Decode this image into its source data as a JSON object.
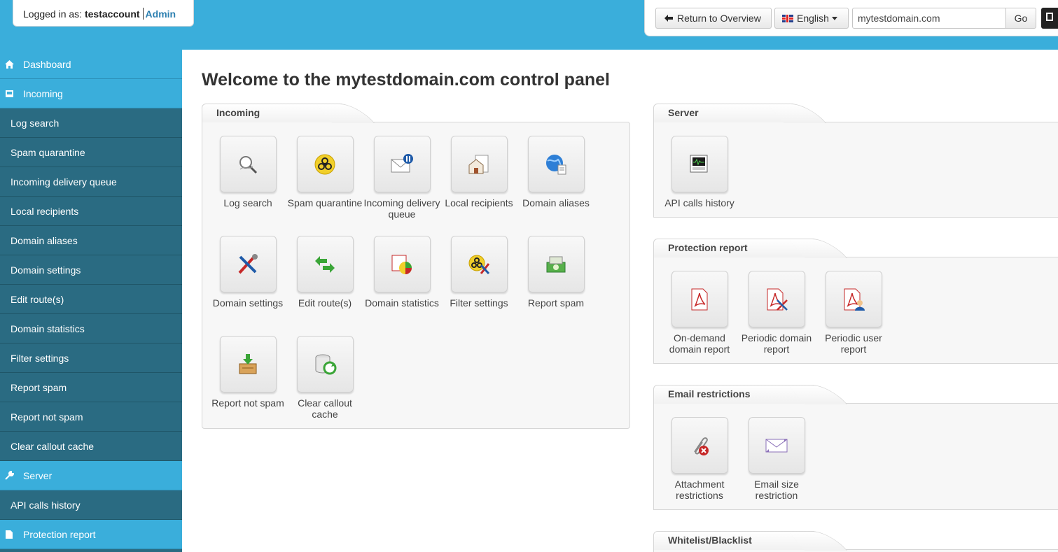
{
  "header": {
    "logged_in_label": "Logged in as:",
    "username": "testaccount",
    "role": "Admin",
    "return_button": "Return to Overview",
    "language_button": "English",
    "domain_value": "mytestdomain.com",
    "go_button": "Go"
  },
  "sidebar": {
    "items": [
      {
        "label": "Dashboard",
        "type": "section",
        "icon": "home-icon"
      },
      {
        "label": "Incoming",
        "type": "section",
        "icon": "inbox-icon"
      },
      {
        "label": "Log search",
        "type": "sub"
      },
      {
        "label": "Spam quarantine",
        "type": "sub"
      },
      {
        "label": "Incoming delivery queue",
        "type": "sub"
      },
      {
        "label": "Local recipients",
        "type": "sub"
      },
      {
        "label": "Domain aliases",
        "type": "sub"
      },
      {
        "label": "Domain settings",
        "type": "sub"
      },
      {
        "label": "Edit route(s)",
        "type": "sub"
      },
      {
        "label": "Domain statistics",
        "type": "sub"
      },
      {
        "label": "Filter settings",
        "type": "sub"
      },
      {
        "label": "Report spam",
        "type": "sub"
      },
      {
        "label": "Report not spam",
        "type": "sub"
      },
      {
        "label": "Clear callout cache",
        "type": "sub"
      },
      {
        "label": "Server",
        "type": "section",
        "icon": "wrench-icon"
      },
      {
        "label": "API calls history",
        "type": "sub"
      },
      {
        "label": "Protection report",
        "type": "section",
        "icon": "file-icon"
      }
    ]
  },
  "main": {
    "title": "Welcome to the mytestdomain.com control panel",
    "incoming": {
      "title": "Incoming",
      "tiles": [
        {
          "label": "Log search",
          "icon": "magnifier-icon"
        },
        {
          "label": "Spam quarantine",
          "icon": "biohazard-icon"
        },
        {
          "label": "Incoming delivery queue",
          "icon": "envelope-pause-icon"
        },
        {
          "label": "Local recipients",
          "icon": "house-icon"
        },
        {
          "label": "Domain aliases",
          "icon": "globe-icon"
        },
        {
          "label": "Domain settings",
          "icon": "tools-icon"
        },
        {
          "label": "Edit route(s)",
          "icon": "arrows-icon"
        },
        {
          "label": "Domain statistics",
          "icon": "pie-chart-icon"
        },
        {
          "label": "Filter settings",
          "icon": "biohazard-tools-icon"
        },
        {
          "label": "Report spam",
          "icon": "money-box-icon"
        },
        {
          "label": "Report not spam",
          "icon": "box-arrow-icon"
        },
        {
          "label": "Clear callout cache",
          "icon": "database-refresh-icon"
        }
      ]
    },
    "server": {
      "title": "Server",
      "tiles": [
        {
          "label": "API calls history",
          "icon": "monitor-icon"
        }
      ]
    },
    "protection": {
      "title": "Protection report",
      "tiles": [
        {
          "label": "On-demand domain report",
          "icon": "pdf-icon"
        },
        {
          "label": "Periodic domain report",
          "icon": "pdf-tools-icon"
        },
        {
          "label": "Periodic user report",
          "icon": "pdf-user-icon"
        }
      ]
    },
    "email_restrictions": {
      "title": "Email restrictions",
      "tiles": [
        {
          "label": "Attachment restrictions",
          "icon": "paperclip-x-icon"
        },
        {
          "label": "Email size restriction",
          "icon": "envelope-icon"
        }
      ]
    },
    "whitelist": {
      "title": "Whitelist/Blacklist"
    }
  },
  "colors": {
    "accent": "#3aaedb",
    "sidebar_dark": "#2a6b82"
  }
}
